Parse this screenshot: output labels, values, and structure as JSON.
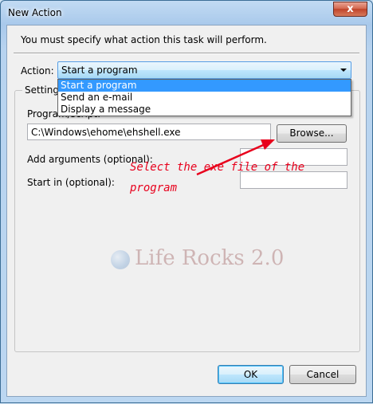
{
  "window": {
    "title": "New Action",
    "close_glyph": "x"
  },
  "dialog": {
    "instruction": "You must specify what action this task will perform.",
    "action_label": "Action:",
    "action_value": "Start a program",
    "action_options": [
      "Start a program",
      "Send an e-mail",
      "Display a message"
    ],
    "settings_title": "Settings",
    "program_label": "Program/script:",
    "program_value": "C:\\Windows\\ehome\\ehshell.exe",
    "browse_label": "Browse...",
    "args_label": "Add arguments (optional):",
    "args_value": "",
    "start_label": "Start in (optional):",
    "start_value": "",
    "ok_label": "OK",
    "cancel_label": "Cancel"
  },
  "annotation": {
    "line1": "Select the exe file of the",
    "line2": "program",
    "color": "#e8001c"
  },
  "watermark": {
    "text": "Life Rocks 2.0"
  }
}
